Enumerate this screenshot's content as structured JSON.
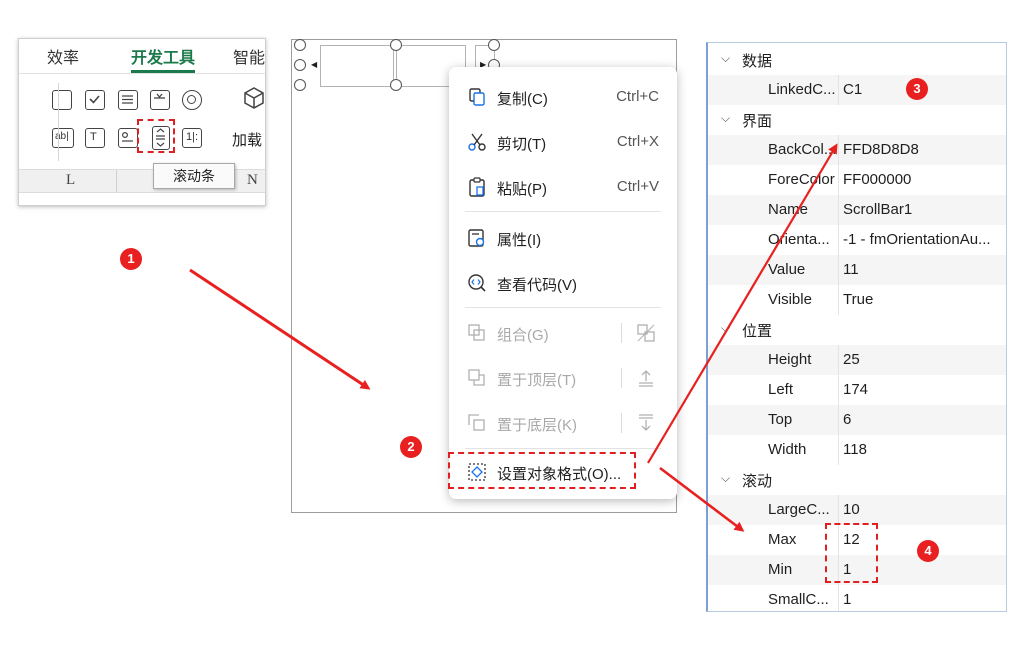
{
  "ribbon": {
    "tabs": [
      "效率",
      "开发工具",
      "智能"
    ],
    "active_tab": "开发工具",
    "load_label": "加载",
    "tooltip": "滚动条",
    "column_headers": [
      "L",
      "N"
    ]
  },
  "context_menu": {
    "items": [
      {
        "label": "复制(C)",
        "shortcut": "Ctrl+C",
        "icon": "copy-icon",
        "enabled": true
      },
      {
        "label": "剪切(T)",
        "shortcut": "Ctrl+X",
        "icon": "cut-icon",
        "enabled": true
      },
      {
        "label": "粘贴(P)",
        "shortcut": "Ctrl+V",
        "icon": "paste-icon",
        "enabled": true
      },
      {
        "label": "属性(I)",
        "shortcut": "",
        "icon": "properties-icon",
        "enabled": true
      },
      {
        "label": "查看代码(V)",
        "shortcut": "",
        "icon": "view-code-icon",
        "enabled": true
      },
      {
        "label": "组合(G)",
        "shortcut": "",
        "icon": "group-icon",
        "enabled": false
      },
      {
        "label": "置于顶层(T)",
        "shortcut": "",
        "icon": "bring-to-front-icon",
        "enabled": false
      },
      {
        "label": "置于底层(K)",
        "shortcut": "",
        "icon": "send-to-back-icon",
        "enabled": false
      },
      {
        "label": "设置对象格式(O)...",
        "shortcut": "",
        "icon": "format-object-icon",
        "enabled": true
      }
    ]
  },
  "properties": {
    "categories": [
      {
        "title": "数据",
        "rows": [
          {
            "name": "LinkedC...",
            "value": "C1"
          }
        ]
      },
      {
        "title": "界面",
        "rows": [
          {
            "name": "BackCol...",
            "value": "FFD8D8D8"
          },
          {
            "name": "ForeColor",
            "value": "FF000000"
          },
          {
            "name": "Name",
            "value": "ScrollBar1"
          },
          {
            "name": "Orienta...",
            "value": "-1 - fmOrientationAu..."
          },
          {
            "name": "Value",
            "value": "11"
          },
          {
            "name": "Visible",
            "value": "True"
          }
        ]
      },
      {
        "title": "位置",
        "rows": [
          {
            "name": "Height",
            "value": "25"
          },
          {
            "name": "Left",
            "value": "174"
          },
          {
            "name": "Top",
            "value": "6"
          },
          {
            "name": "Width",
            "value": "118"
          }
        ]
      },
      {
        "title": "滚动",
        "rows": [
          {
            "name": "LargeC...",
            "value": "10"
          },
          {
            "name": "Max",
            "value": "12"
          },
          {
            "name": "Min",
            "value": "1"
          },
          {
            "name": "SmallC...",
            "value": "1"
          }
        ]
      }
    ]
  },
  "badges": [
    "1",
    "2",
    "3",
    "4"
  ],
  "colors": {
    "accent_green": "#1b7a4a",
    "annotation_red": "#e8201f"
  }
}
